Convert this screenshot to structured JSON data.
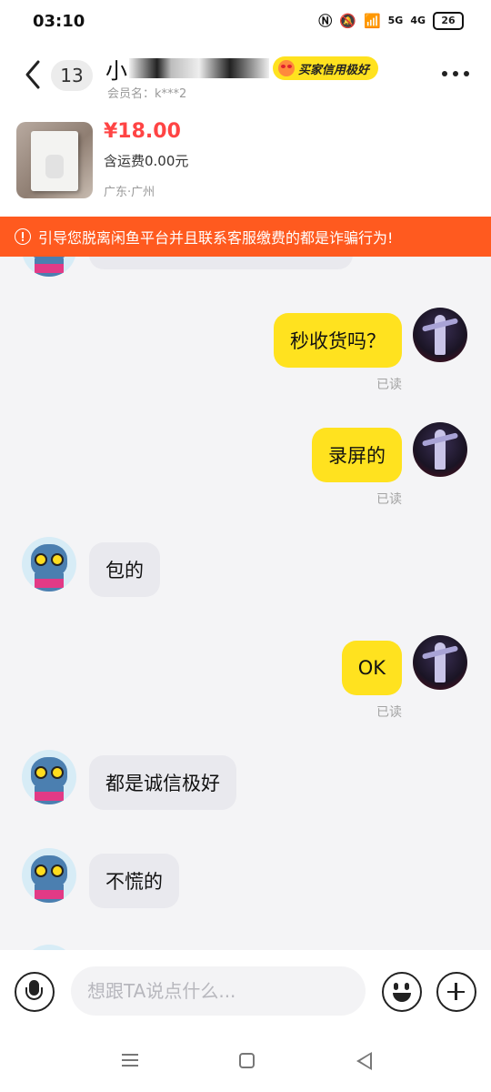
{
  "status_bar": {
    "time": "03:10",
    "network": "5G",
    "network2": "4G",
    "battery": "26"
  },
  "header": {
    "unread_count": "13",
    "name_prefix": "小",
    "name_suffix": "",
    "badge": "买家信用极好",
    "member_label": "会员名：k***2"
  },
  "product": {
    "price": "¥18.00",
    "shipping": "含运费0.00元",
    "location": "广东·广州"
  },
  "warning": {
    "text": "引导您脱离闲鱼平台并且联系客服缴费的都是诈骗行为!"
  },
  "messages": [
    {
      "from": "me",
      "text": "秒收货吗？",
      "status": "已读"
    },
    {
      "from": "me",
      "text": "录屏的",
      "status": "已读"
    },
    {
      "from": "other",
      "text": "包的"
    },
    {
      "from": "me",
      "text": "OK",
      "status": "已读"
    },
    {
      "from": "other",
      "text": "都是诚信极好"
    },
    {
      "from": "other",
      "text": "不慌的"
    }
  ],
  "input": {
    "placeholder": "想跟TA说点什么..."
  }
}
